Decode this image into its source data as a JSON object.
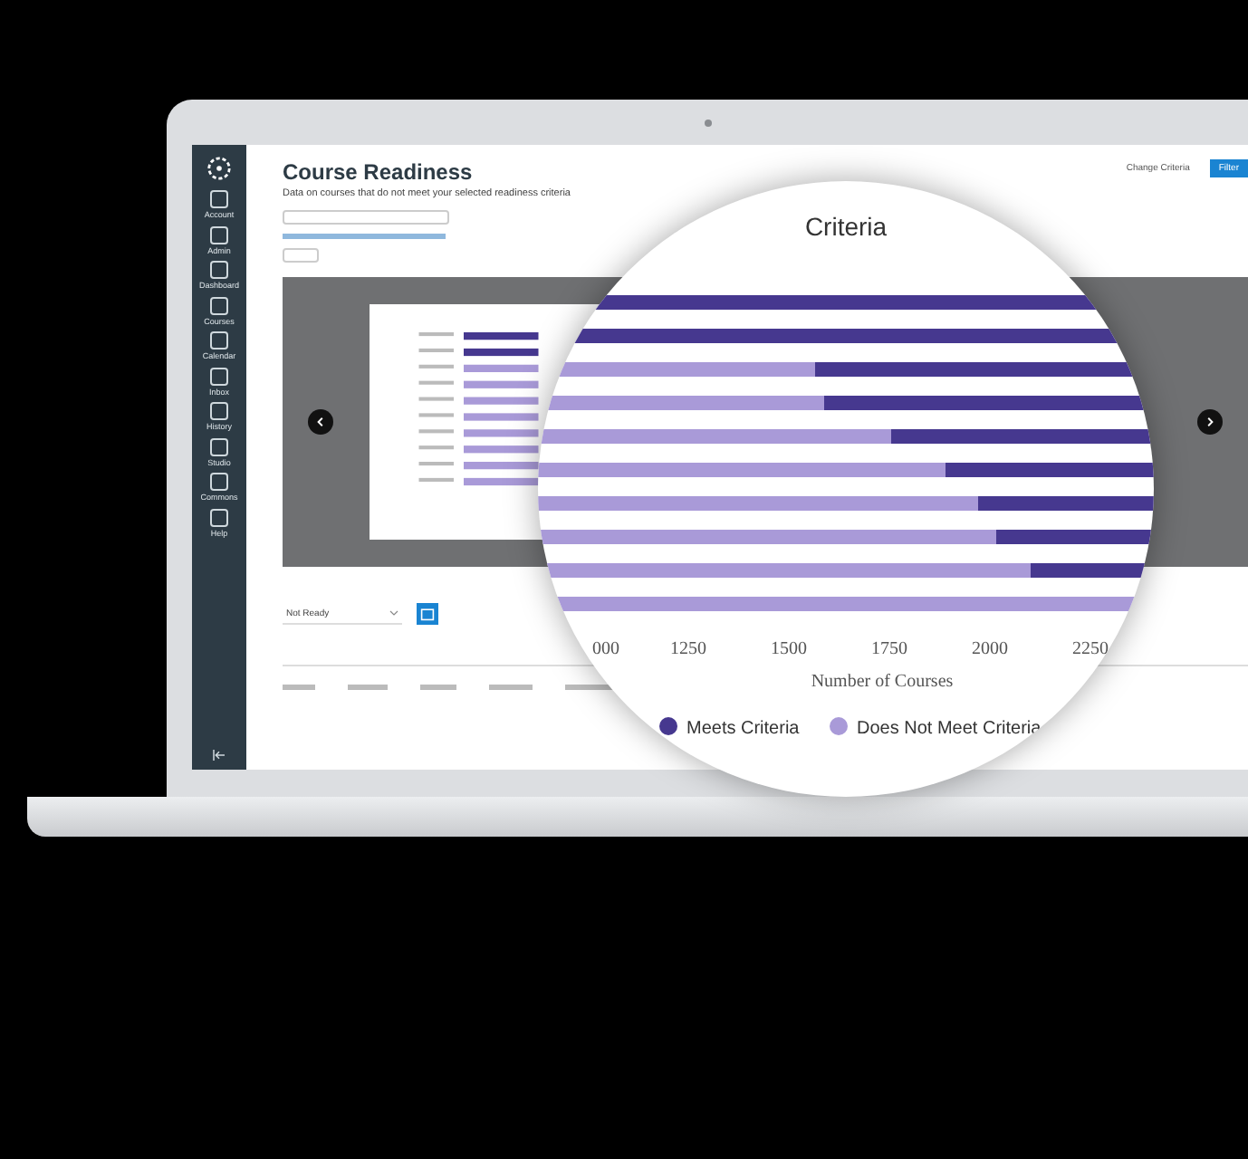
{
  "app": {
    "title": "Course Readiness",
    "subtitle": "Data on courses that do not meet your selected readiness criteria",
    "header_buttons": [
      {
        "label": "Change Criteria",
        "kind": "link"
      },
      {
        "label": "Filter",
        "kind": "primary"
      }
    ]
  },
  "sidebar": {
    "items": [
      {
        "label": "Account"
      },
      {
        "label": "Admin"
      },
      {
        "label": "Dashboard"
      },
      {
        "label": "Courses"
      },
      {
        "label": "Calendar"
      },
      {
        "label": "Inbox"
      },
      {
        "label": "History"
      },
      {
        "label": "Studio"
      },
      {
        "label": "Commons"
      },
      {
        "label": "Help"
      }
    ]
  },
  "status_select": {
    "value": "Not Ready"
  },
  "magnifier": {
    "title": "Criteria",
    "tick_labels": [
      "000",
      "1250",
      "1500",
      "1750",
      "2000",
      "2250"
    ],
    "axis_title": "Number of Courses",
    "legend": [
      {
        "label": "Meets Criteria",
        "color": "#46388f"
      },
      {
        "label": "Does Not Meet Criteria",
        "color": "#a99ad8"
      }
    ]
  }
}
